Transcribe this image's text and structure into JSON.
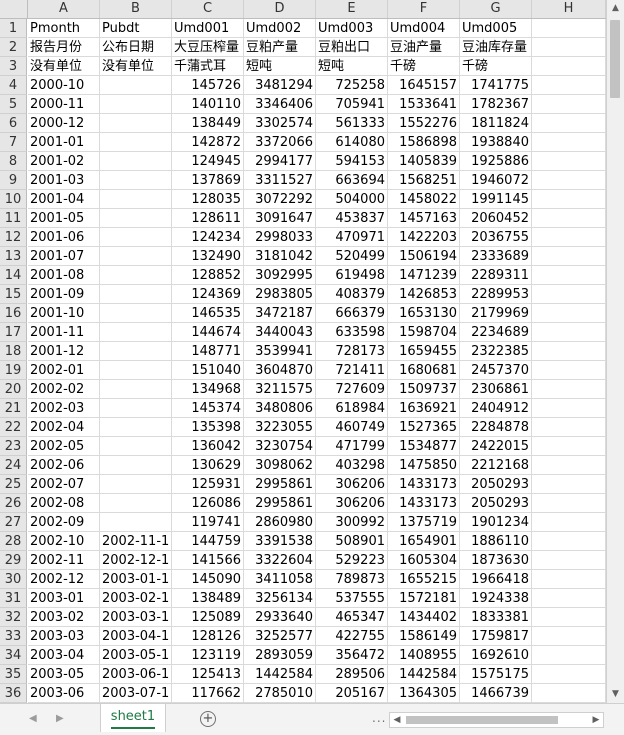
{
  "columns": [
    "A",
    "B",
    "C",
    "D",
    "E",
    "F",
    "G",
    "H"
  ],
  "rows": [
    {
      "n": "1",
      "cells": [
        "Pmonth",
        "Pubdt",
        "Umd001",
        "Umd002",
        "Umd003",
        "Umd004",
        "Umd005",
        ""
      ]
    },
    {
      "n": "2",
      "cells": [
        "报告月份",
        "公布日期",
        "大豆压榨量",
        "豆粕产量",
        "豆粕出口",
        "豆油产量",
        "豆油库存量",
        ""
      ]
    },
    {
      "n": "3",
      "cells": [
        "没有单位",
        "没有单位",
        "千蒲式耳",
        "短吨",
        "短吨",
        "千磅",
        "千磅",
        ""
      ]
    },
    {
      "n": "4",
      "cells": [
        "2000-10",
        "",
        "145726",
        "3481294",
        "725258",
        "1645157",
        "1741775",
        ""
      ]
    },
    {
      "n": "5",
      "cells": [
        "2000-11",
        "",
        "140110",
        "3346406",
        "705941",
        "1533641",
        "1782367",
        ""
      ]
    },
    {
      "n": "6",
      "cells": [
        "2000-12",
        "",
        "138449",
        "3302574",
        "561333",
        "1552276",
        "1811824",
        ""
      ]
    },
    {
      "n": "7",
      "cells": [
        "2001-01",
        "",
        "142872",
        "3372066",
        "614080",
        "1586898",
        "1938840",
        ""
      ]
    },
    {
      "n": "8",
      "cells": [
        "2001-02",
        "",
        "124945",
        "2994177",
        "594153",
        "1405839",
        "1925886",
        ""
      ]
    },
    {
      "n": "9",
      "cells": [
        "2001-03",
        "",
        "137869",
        "3311527",
        "663694",
        "1568251",
        "1946072",
        ""
      ]
    },
    {
      "n": "10",
      "cells": [
        "2001-04",
        "",
        "128035",
        "3072292",
        "504000",
        "1458022",
        "1991145",
        ""
      ]
    },
    {
      "n": "11",
      "cells": [
        "2001-05",
        "",
        "128611",
        "3091647",
        "453837",
        "1457163",
        "2060452",
        ""
      ]
    },
    {
      "n": "12",
      "cells": [
        "2001-06",
        "",
        "124234",
        "2998033",
        "470971",
        "1422203",
        "2036755",
        ""
      ]
    },
    {
      "n": "13",
      "cells": [
        "2001-07",
        "",
        "132490",
        "3181042",
        "520499",
        "1506194",
        "2333689",
        ""
      ]
    },
    {
      "n": "14",
      "cells": [
        "2001-08",
        "",
        "128852",
        "3092995",
        "619498",
        "1471239",
        "2289311",
        ""
      ]
    },
    {
      "n": "15",
      "cells": [
        "2001-09",
        "",
        "124369",
        "2983805",
        "408379",
        "1426853",
        "2289953",
        ""
      ]
    },
    {
      "n": "16",
      "cells": [
        "2001-10",
        "",
        "146535",
        "3472187",
        "666379",
        "1653130",
        "2179969",
        ""
      ]
    },
    {
      "n": "17",
      "cells": [
        "2001-11",
        "",
        "144674",
        "3440043",
        "633598",
        "1598704",
        "2234689",
        ""
      ]
    },
    {
      "n": "18",
      "cells": [
        "2001-12",
        "",
        "148771",
        "3539941",
        "728173",
        "1659455",
        "2322385",
        ""
      ]
    },
    {
      "n": "19",
      "cells": [
        "2002-01",
        "",
        "151040",
        "3604870",
        "721411",
        "1680681",
        "2457370",
        ""
      ]
    },
    {
      "n": "20",
      "cells": [
        "2002-02",
        "",
        "134968",
        "3211575",
        "727609",
        "1509737",
        "2306861",
        ""
      ]
    },
    {
      "n": "21",
      "cells": [
        "2002-03",
        "",
        "145374",
        "3480806",
        "618984",
        "1636921",
        "2404912",
        ""
      ]
    },
    {
      "n": "22",
      "cells": [
        "2002-04",
        "",
        "135398",
        "3223055",
        "460749",
        "1527365",
        "2284878",
        ""
      ]
    },
    {
      "n": "23",
      "cells": [
        "2002-05",
        "",
        "136042",
        "3230754",
        "471799",
        "1534877",
        "2422015",
        ""
      ]
    },
    {
      "n": "24",
      "cells": [
        "2002-06",
        "",
        "130629",
        "3098062",
        "403298",
        "1475850",
        "2212168",
        ""
      ]
    },
    {
      "n": "25",
      "cells": [
        "2002-07",
        "",
        "125931",
        "2995861",
        "306206",
        "1433173",
        "2050293",
        ""
      ]
    },
    {
      "n": "26",
      "cells": [
        "2002-08",
        "",
        "126086",
        "2995861",
        "306206",
        "1433173",
        "2050293",
        ""
      ]
    },
    {
      "n": "27",
      "cells": [
        "2002-09",
        "",
        "119741",
        "2860980",
        "300992",
        "1375719",
        "1901234",
        ""
      ]
    },
    {
      "n": "28",
      "cells": [
        "2002-10",
        "2002-11-1",
        "144759",
        "3391538",
        "508901",
        "1654901",
        "1886110",
        ""
      ]
    },
    {
      "n": "29",
      "cells": [
        "2002-11",
        "2002-12-1",
        "141566",
        "3322604",
        "529223",
        "1605304",
        "1873630",
        ""
      ]
    },
    {
      "n": "30",
      "cells": [
        "2002-12",
        "2003-01-1",
        "145090",
        "3411058",
        "789873",
        "1655215",
        "1966418",
        ""
      ]
    },
    {
      "n": "31",
      "cells": [
        "2003-01",
        "2003-02-1",
        "138489",
        "3256134",
        "537555",
        "1572181",
        "1924338",
        ""
      ]
    },
    {
      "n": "32",
      "cells": [
        "2003-02",
        "2003-03-1",
        "125089",
        "2933640",
        "465347",
        "1434402",
        "1833381",
        ""
      ]
    },
    {
      "n": "33",
      "cells": [
        "2003-03",
        "2003-04-1",
        "128126",
        "3252577",
        "422755",
        "1586149",
        "1759817",
        ""
      ]
    },
    {
      "n": "34",
      "cells": [
        "2003-04",
        "2003-05-1",
        "123119",
        "2893059",
        "356472",
        "1408955",
        "1692610",
        ""
      ]
    },
    {
      "n": "35",
      "cells": [
        "2003-05",
        "2003-06-1",
        "125413",
        "1442584",
        "289506",
        "1442584",
        "1575175",
        ""
      ]
    },
    {
      "n": "36",
      "cells": [
        "2003-06",
        "2003-07-1",
        "117662",
        "2785010",
        "205167",
        "1364305",
        "1466739",
        ""
      ]
    }
  ],
  "sheet_tab": {
    "label": "sheet1"
  },
  "controls": {
    "add_sheet": "+",
    "more": "...",
    "prev": "◀",
    "next": "▶",
    "up": "▲",
    "down": "▼"
  }
}
